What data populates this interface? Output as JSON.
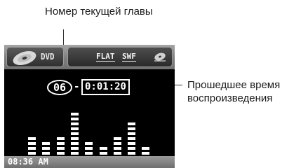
{
  "callouts": {
    "current_chapter": "Номер текущей главы",
    "elapsed_line1": "Прошедшее время",
    "elapsed_line2": "воспроизведения"
  },
  "display": {
    "source_label": "DVD",
    "eq_mode": "FLAT",
    "surround_mode": "SWF",
    "chapter_number": "06",
    "separator": "-",
    "elapsed_time": "0:01:20",
    "clock": "08:36 AM"
  },
  "spectrum_levels": [
    4,
    3,
    4,
    9,
    3,
    2,
    4,
    7,
    2
  ],
  "colors": {
    "screen_bg": "#000000",
    "bar_fill": "#ffffff",
    "panel_gray": "#8a8a8a"
  },
  "icons": {
    "source": "disc-icon",
    "mode": "disc-small-icon"
  }
}
